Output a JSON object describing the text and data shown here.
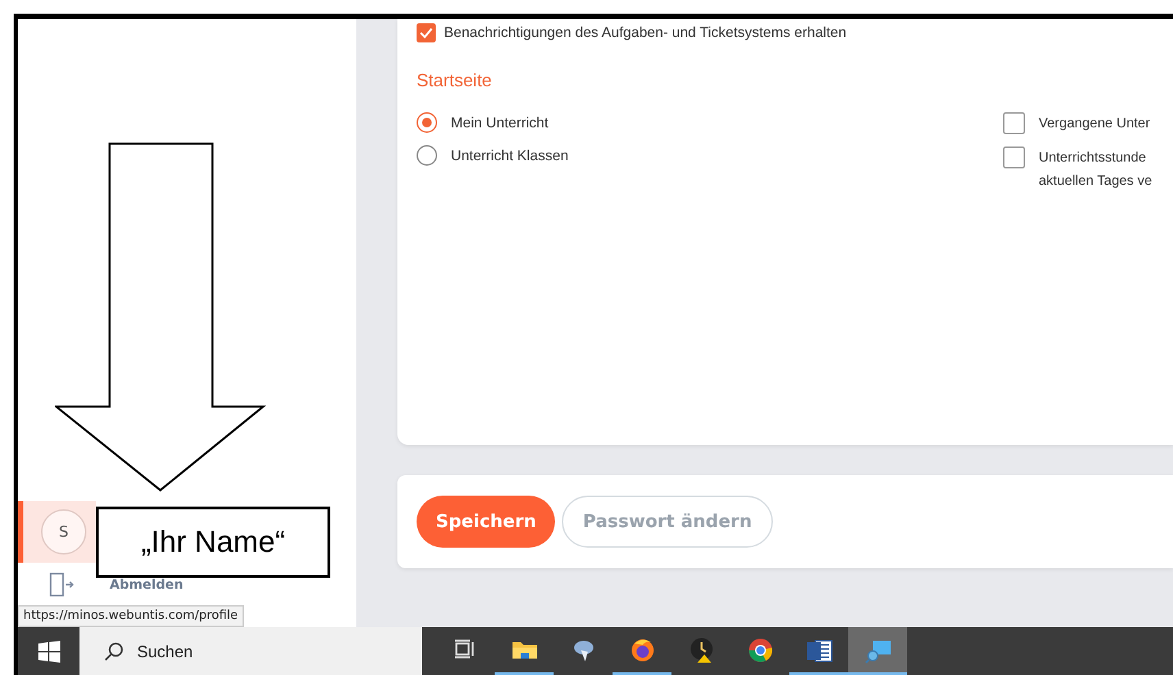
{
  "settings": {
    "notification": {
      "label": "Benachrichtigungen des Aufgaben- und Ticketsystems erhalten",
      "checked": true
    },
    "section_title": "Startseite",
    "start_options": [
      {
        "label": "Mein Unterricht",
        "selected": true
      },
      {
        "label": "Unterricht Klassen",
        "selected": false
      }
    ],
    "options": [
      {
        "lines": [
          "Vergangene Unter"
        ],
        "checked": false
      },
      {
        "lines": [
          "Unterrichtsstunde",
          "aktuellen Tages ve"
        ],
        "checked": false
      }
    ]
  },
  "actions": [
    {
      "label": "Speichern",
      "kind": "primary"
    },
    {
      "label": "Passwort ändern",
      "kind": "secondary"
    }
  ],
  "sidebar": {
    "avatar": "S",
    "selected": true,
    "logout": "Abmelden"
  },
  "tooltip": "https://minos.webuntis.com/profile",
  "annotation": {
    "label": "„Ihr Name“"
  },
  "taskbar": {
    "search_placeholder": "Suchen",
    "apps": [
      {
        "kind": "taskview",
        "running": false,
        "selected": false
      },
      {
        "kind": "folder",
        "running": true,
        "selected": false
      },
      {
        "kind": "tool",
        "running": false,
        "selected": false
      },
      {
        "kind": "firefox",
        "running": true,
        "selected": false
      },
      {
        "kind": "clock",
        "running": false,
        "selected": false
      },
      {
        "kind": "chrome",
        "running": false,
        "selected": false
      },
      {
        "kind": "word",
        "running": true,
        "selected": false
      },
      {
        "kind": "remote",
        "running": true,
        "selected": true
      }
    ]
  }
}
